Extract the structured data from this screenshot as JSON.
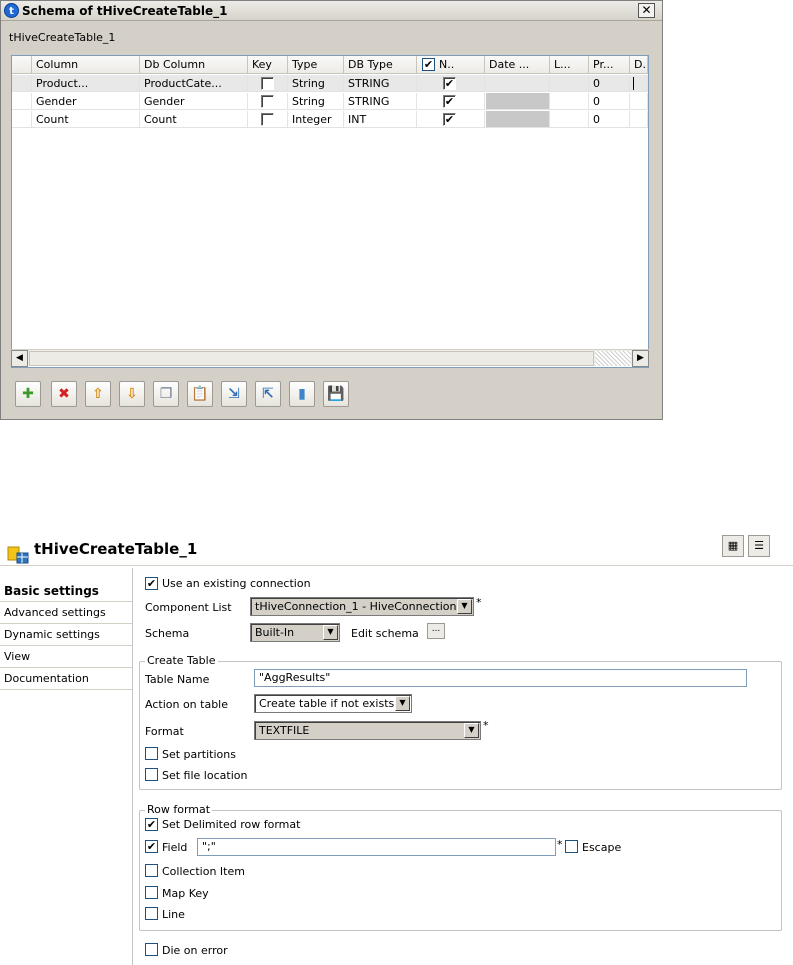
{
  "schema_dialog": {
    "title": "Schema of tHiveCreateTable_1",
    "close_icon": "✕",
    "subtitle": "tHiveCreateTable_1",
    "columns": [
      "Column",
      "Db Column",
      "Key",
      "Type",
      "DB Type",
      "N..",
      "Date ...",
      "L...",
      "Pr...",
      "D.."
    ],
    "rows": [
      {
        "column": "Product...",
        "db_column": "ProductCate...",
        "key": false,
        "type": "String",
        "db_type": "STRING",
        "nullable": true,
        "precision": "0"
      },
      {
        "column": "Gender",
        "db_column": "Gender",
        "key": false,
        "type": "String",
        "db_type": "STRING",
        "nullable": true,
        "precision": "0"
      },
      {
        "column": "Count",
        "db_column": "Count",
        "key": false,
        "type": "Integer",
        "db_type": "INT",
        "nullable": true,
        "precision": "0"
      }
    ],
    "scroll_left": "◀",
    "scroll_right": "▶",
    "toolbar": [
      {
        "name": "add-icon",
        "glyph": "✚",
        "color": "#3a9a2a"
      },
      {
        "name": "delete-icon",
        "glyph": "✖",
        "color": "#d42020"
      },
      {
        "name": "move-up-icon",
        "glyph": "⇧",
        "color": "#d98a10"
      },
      {
        "name": "move-down-icon",
        "glyph": "⇩",
        "color": "#d98a10"
      },
      {
        "name": "copy-icon",
        "glyph": "❐",
        "color": "#6b7b90"
      },
      {
        "name": "paste-icon",
        "glyph": "📋",
        "color": "#8a6d2b"
      },
      {
        "name": "import-icon",
        "glyph": "⇲",
        "color": "#2f6db5"
      },
      {
        "name": "export-icon",
        "glyph": "⇱",
        "color": "#2f6db5"
      },
      {
        "name": "repository-icon",
        "glyph": "▮",
        "color": "#3a86c8"
      },
      {
        "name": "save-icon",
        "glyph": "💾",
        "color": "#2b4e9e"
      }
    ]
  },
  "component": {
    "title": "tHiveCreateTable_1",
    "sidebar": [
      "Basic settings",
      "Advanced settings",
      "Dynamic settings",
      "View",
      "Documentation"
    ],
    "use_existing_connection": "Use an existing connection",
    "component_list_label": "Component List",
    "component_list_value": "tHiveConnection_1 - HiveConnection",
    "schema_label": "Schema",
    "schema_value": "Built-In",
    "edit_schema_label": "Edit schema",
    "edit_schema_btn": "...",
    "create_table": {
      "title": "Create Table",
      "table_name_label": "Table Name",
      "table_name_value": "\"AggResults\"",
      "action_label": "Action on table",
      "action_value": "Create table if not exists",
      "format_label": "Format",
      "format_value": "TEXTFILE",
      "set_partitions": "Set partitions",
      "set_file_location": "Set file location"
    },
    "row_format": {
      "title": "Row format",
      "set_delimited": "Set Delimited row format",
      "field_label": "Field",
      "field_value": "\";\"",
      "escape_label": "Escape",
      "collection_item": "Collection Item",
      "map_key": "Map Key",
      "line": "Line"
    },
    "die_on_error": "Die on error",
    "required_mark": "*",
    "check_mark": "✔",
    "dropdown_arrow": "▼"
  }
}
